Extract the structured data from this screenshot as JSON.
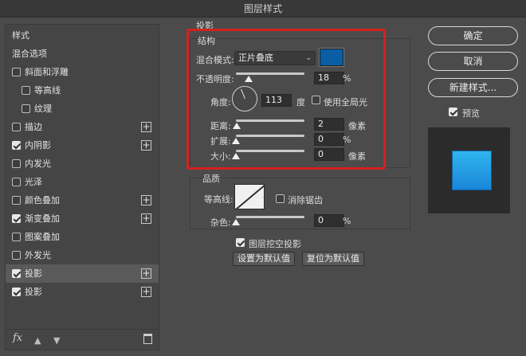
{
  "window": {
    "title": "图层样式"
  },
  "sidebar": {
    "header": "样式",
    "items": [
      {
        "label": "混合选项",
        "checkbox": false,
        "checked": false,
        "plus": false,
        "indent": false,
        "active": false
      },
      {
        "label": "斜面和浮雕",
        "checkbox": true,
        "checked": false,
        "plus": false,
        "indent": false,
        "active": false
      },
      {
        "label": "等高线",
        "checkbox": true,
        "checked": false,
        "plus": false,
        "indent": true,
        "active": false
      },
      {
        "label": "纹理",
        "checkbox": true,
        "checked": false,
        "plus": false,
        "indent": true,
        "active": false
      },
      {
        "label": "描边",
        "checkbox": true,
        "checked": false,
        "plus": true,
        "indent": false,
        "active": false
      },
      {
        "label": "内阴影",
        "checkbox": true,
        "checked": true,
        "plus": true,
        "indent": false,
        "active": false
      },
      {
        "label": "内发光",
        "checkbox": true,
        "checked": false,
        "plus": false,
        "indent": false,
        "active": false
      },
      {
        "label": "光泽",
        "checkbox": true,
        "checked": false,
        "plus": false,
        "indent": false,
        "active": false
      },
      {
        "label": "颜色叠加",
        "checkbox": true,
        "checked": false,
        "plus": true,
        "indent": false,
        "active": false
      },
      {
        "label": "渐变叠加",
        "checkbox": true,
        "checked": true,
        "plus": true,
        "indent": false,
        "active": false
      },
      {
        "label": "图案叠加",
        "checkbox": true,
        "checked": false,
        "plus": false,
        "indent": false,
        "active": false
      },
      {
        "label": "外发光",
        "checkbox": true,
        "checked": false,
        "plus": false,
        "indent": false,
        "active": false
      },
      {
        "label": "投影",
        "checkbox": true,
        "checked": true,
        "plus": true,
        "indent": false,
        "active": true
      },
      {
        "label": "投影",
        "checkbox": true,
        "checked": true,
        "plus": true,
        "indent": false,
        "active": false
      }
    ],
    "footer": {
      "fx": "fx"
    }
  },
  "drop_shadow": {
    "section_title": "投影",
    "structure": {
      "title": "结构",
      "blend_mode_label": "混合模式:",
      "blend_mode_value": "正片叠底",
      "color": "#0a5ea3",
      "opacity_label": "不透明度:",
      "opacity_value": "18",
      "opacity_unit": "%",
      "opacity_fraction": 0.18,
      "angle_label": "角度:",
      "angle_value": "113",
      "angle_unit": "度",
      "global_light_label": "使用全局光",
      "distance_label": "距离:",
      "distance_value": "2",
      "distance_unit": "像素",
      "spread_label": "扩展:",
      "spread_value": "0",
      "spread_unit": "%",
      "size_label": "大小:",
      "size_value": "0",
      "size_unit": "像素"
    },
    "quality": {
      "title": "品质",
      "contour_label": "等高线:",
      "anti_alias_label": "消除锯齿",
      "noise_label": "杂色:",
      "noise_value": "0",
      "noise_unit": "%"
    },
    "knockout_label": "图层挖空投影",
    "make_default": "设置为默认值",
    "reset_default": "复位为默认值"
  },
  "actions": {
    "ok": "确定",
    "cancel": "取消",
    "new_style": "新建样式...",
    "preview_label": "预览"
  },
  "colors": {
    "highlight_border": "#d42020",
    "preview_fill": "#2fb6ee"
  }
}
